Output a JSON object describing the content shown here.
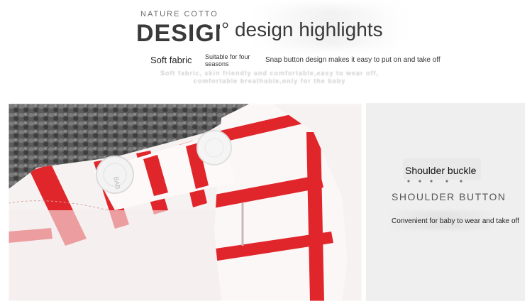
{
  "header": {
    "eyebrow": "NATURE COTTON",
    "bigword": "DESIGN",
    "headline": "° design highlights",
    "features": {
      "soft": "Soft fabric",
      "seasons": "Suitable for four seasons",
      "snap": "Snap button design makes it easy to put on and take off"
    },
    "blur_line_1": "Soft fabric, skin friendly and comfortable,easy to wear off,",
    "blur_line_2": "comfortable breathable,only for the baby"
  },
  "photo": {
    "button_imprint": "BAB"
  },
  "info": {
    "title": "Shoulder buckle",
    "subtitle": "SHOULDER BUTTON",
    "description": "Convenient for baby to wear and take off"
  },
  "colors": {
    "stripe_red": "#e0262b",
    "fabric_white": "#f8f4f4",
    "knit_gray": "#5a5a5a",
    "panel_gray": "#efefef"
  }
}
